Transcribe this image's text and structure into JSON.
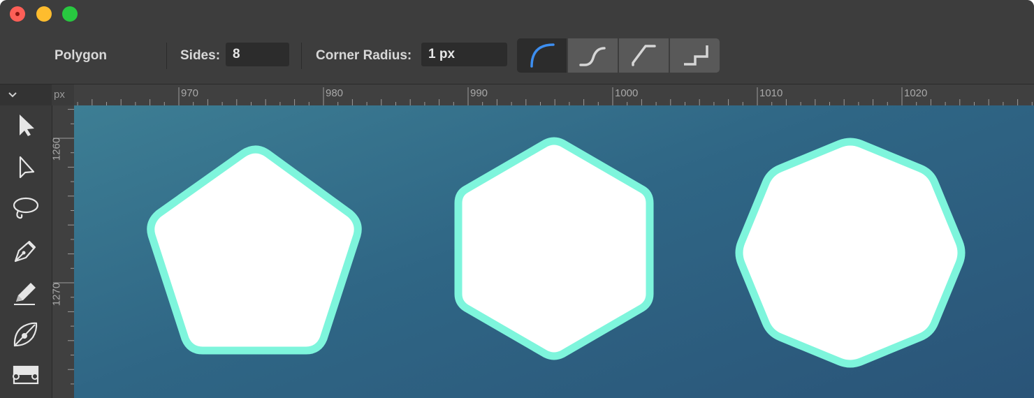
{
  "window": {
    "traffic_lights": [
      "close",
      "minimize",
      "zoom"
    ]
  },
  "context_toolbar": {
    "tool_name": "Polygon",
    "sides_label": "Sides:",
    "sides_value": "8",
    "corner_radius_label": "Corner Radius:",
    "corner_radius_value": "1 px",
    "corner_types": [
      {
        "icon": "rounded-corner-icon",
        "active": true
      },
      {
        "icon": "concave-corner-icon",
        "active": false
      },
      {
        "icon": "straight-corner-icon",
        "active": false
      },
      {
        "icon": "stepped-corner-icon",
        "active": false
      }
    ]
  },
  "rulers": {
    "unit": "px",
    "horizontal_labels": [
      "970",
      "980",
      "990",
      "1000",
      "1010",
      "1020"
    ],
    "vertical_labels": [
      "1260",
      "1270"
    ]
  },
  "tools": [
    {
      "icon": "move-tool-icon"
    },
    {
      "icon": "node-tool-icon"
    },
    {
      "icon": "lasso-tool-icon"
    },
    {
      "icon": "pen-tool-icon"
    },
    {
      "icon": "pencil-tool-icon"
    },
    {
      "icon": "vector-brush-tool-icon"
    },
    {
      "icon": "fill-tool-icon"
    }
  ],
  "canvas": {
    "shapes": [
      {
        "type": "pentagon",
        "sides": 5
      },
      {
        "type": "hexagon",
        "sides": 6
      },
      {
        "type": "octagon",
        "sides": 8
      }
    ],
    "colors": {
      "fill": "#ffffff",
      "stroke": "#7ef5dc",
      "background_top": "#3d7e94",
      "background_bottom": "#2a5478",
      "accent": "#3d8ef0"
    }
  }
}
